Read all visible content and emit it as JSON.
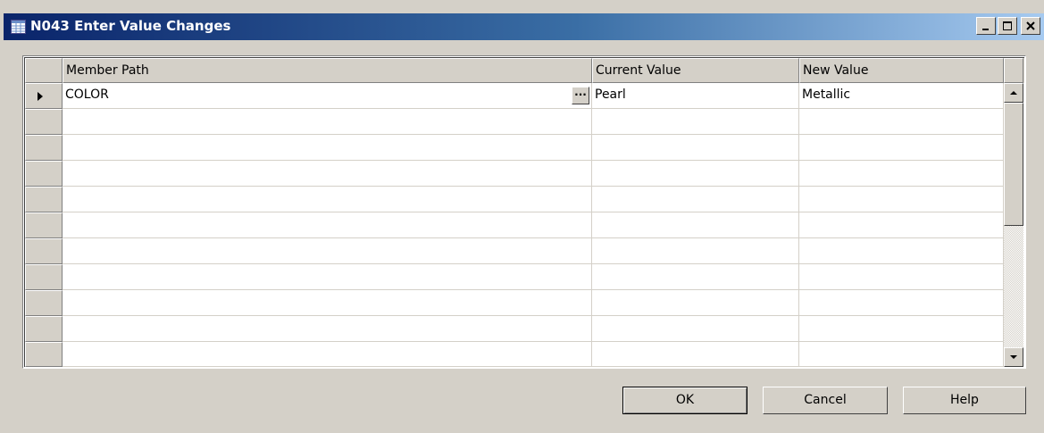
{
  "window": {
    "title": "N043 Enter Value Changes",
    "icon": "table-form-icon",
    "controls": [
      "minimize-icon",
      "maximize-icon",
      "close-icon"
    ]
  },
  "grid": {
    "columns": [
      "Member Path",
      "Current Value",
      "New Value"
    ],
    "rows": [
      {
        "member_path": "COLOR",
        "current_value": "Pearl",
        "new_value": "Metallic",
        "selected": true
      }
    ],
    "assist_button_label": "..."
  },
  "buttons": {
    "ok": "OK",
    "cancel": "Cancel",
    "help": "Help"
  },
  "colors": {
    "face": "#d4d0c8",
    "titlebar_start": "#0a246a",
    "titlebar_end": "#a6caf0"
  }
}
